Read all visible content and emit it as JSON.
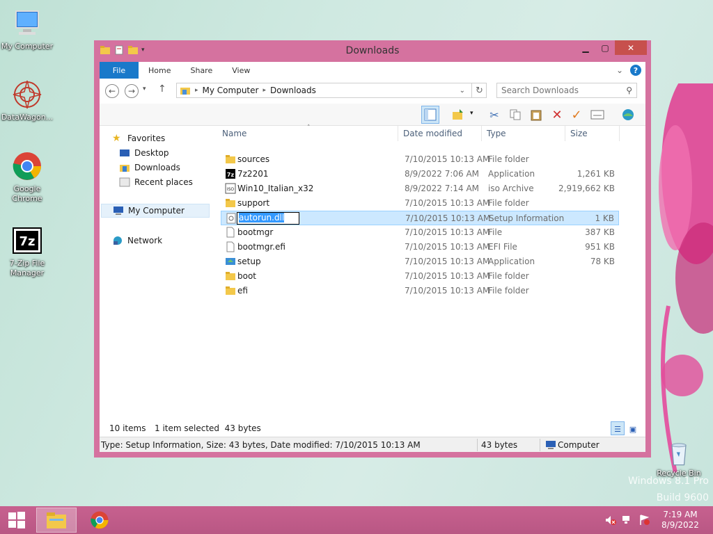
{
  "desktop": {
    "icons": [
      {
        "label": "My Computer"
      },
      {
        "label": "DataWagon..."
      },
      {
        "label": "Google Chrome"
      },
      {
        "label": "7-Zip File Manager"
      },
      {
        "label": "Recycle Bin"
      }
    ],
    "watermark_line1": "Windows 8.1 Pro",
    "watermark_line2": "Build 9600"
  },
  "window": {
    "title": "Downloads",
    "ribbon_tabs": [
      "File",
      "Home",
      "Share",
      "View"
    ],
    "address": {
      "segments": [
        "My Computer",
        "Downloads"
      ],
      "search_placeholder": "Search Downloads"
    },
    "nav_pane": {
      "favorites": "Favorites",
      "items": [
        "Desktop",
        "Downloads",
        "Recent places"
      ],
      "computer": "My Computer",
      "network": "Network"
    },
    "columns": {
      "name": "Name",
      "date": "Date modified",
      "type": "Type",
      "size": "Size"
    },
    "files": [
      {
        "name": "sources",
        "date": "7/10/2015 10:13 AM",
        "type": "File folder",
        "size": "",
        "icon": "folder-icon"
      },
      {
        "name": "7z2201",
        "date": "8/9/2022 7:06 AM",
        "type": "Application",
        "size": "1,261 KB",
        "icon": "7zip-app-icon"
      },
      {
        "name": "Win10_Italian_x32",
        "date": "8/9/2022 7:14 AM",
        "type": "iso Archive",
        "size": "2,919,662 KB",
        "icon": "iso-archive-icon"
      },
      {
        "name": "support",
        "date": "7/10/2015 10:13 AM",
        "type": "File folder",
        "size": "",
        "icon": "folder-icon"
      },
      {
        "name": "autorun.dll",
        "date": "7/10/2015 10:13 AM",
        "type": "Setup Information",
        "size": "1 KB",
        "icon": "setup-info-icon"
      },
      {
        "name": "bootmgr",
        "date": "7/10/2015 10:13 AM",
        "type": "File",
        "size": "387 KB",
        "icon": "file-icon"
      },
      {
        "name": "bootmgr.efi",
        "date": "7/10/2015 10:13 AM",
        "type": "EFI File",
        "size": "951 KB",
        "icon": "file-icon"
      },
      {
        "name": "setup",
        "date": "7/10/2015 10:13 AM",
        "type": "Application",
        "size": "78 KB",
        "icon": "setup-app-icon"
      },
      {
        "name": "boot",
        "date": "7/10/2015 10:13 AM",
        "type": "File folder",
        "size": "",
        "icon": "folder-icon"
      },
      {
        "name": "efi",
        "date": "7/10/2015 10:13 AM",
        "type": "File folder",
        "size": "",
        "icon": "folder-icon"
      }
    ],
    "status": {
      "count": "10 items",
      "selection": "1 item selected  43 bytes"
    },
    "details": {
      "info": "Type: Setup Information, Size: 43 bytes, Date modified: 7/10/2015 10:13 AM",
      "size": "43 bytes",
      "location": "Computer"
    }
  },
  "taskbar": {
    "time": "7:19 AM",
    "date": "8/9/2022"
  },
  "colors": {
    "window_frame": "#d5729f",
    "taskbar": "#c7618f",
    "accent": "#1979ca",
    "selection": "#cce8ff"
  }
}
